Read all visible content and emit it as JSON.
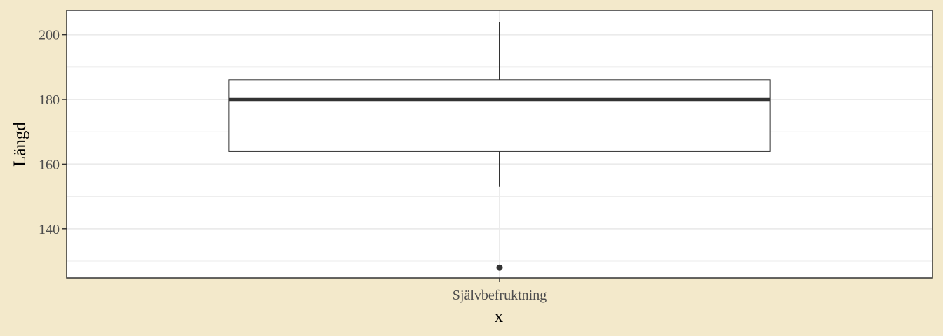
{
  "chart_data": {
    "type": "boxplot",
    "xlabel": "x",
    "ylabel": "Längd",
    "categories": [
      "Självbefruktning"
    ],
    "ylim": [
      124.8,
      207.5
    ],
    "y_ticks": [
      140,
      160,
      180,
      200
    ],
    "y_minor_ticks": [
      130,
      150,
      170,
      190
    ],
    "grid": true,
    "boxes": [
      {
        "category": "Självbefruktning",
        "whisker_low": 153,
        "q1": 164,
        "median": 180,
        "q3": 186,
        "whisker_high": 204,
        "outliers": [
          128
        ]
      }
    ],
    "colors": {
      "background": "#f3e9cb",
      "panel": "#ffffff",
      "grid": "#ebebeb",
      "box_line": "#333333",
      "border": "#333333",
      "tick_text": "#4d4d4d"
    }
  }
}
